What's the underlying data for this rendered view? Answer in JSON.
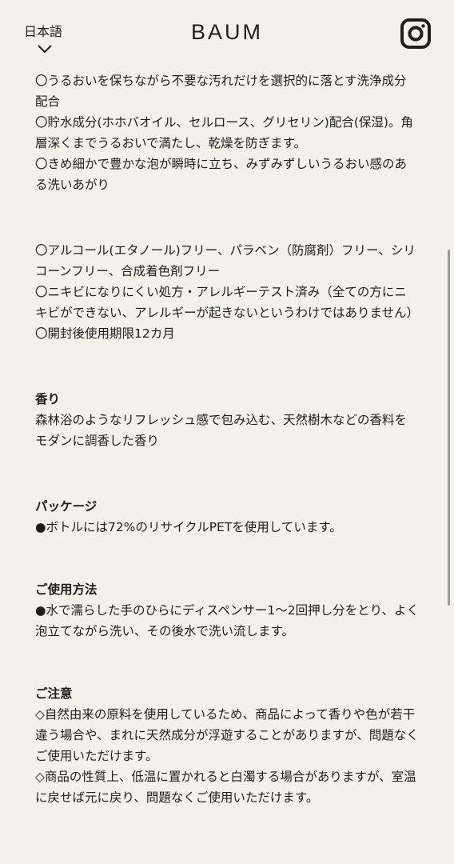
{
  "header": {
    "language_label": "日本語",
    "brand": "BAUM",
    "icons": {
      "language_chevron": "chevron-down-icon",
      "social": "instagram-icon"
    }
  },
  "sections": {
    "features": [
      "〇うるおいを保ちながら不要な汚れだけを選択的に落とす洗浄成分配合",
      "〇貯水成分(ホホバオイル、セルロース、グリセリン)配合(保湿)。角層深くまでうるおいで満たし、乾燥を防ぎます。",
      "〇きめ細かで豊かな泡が瞬時に立ち、みずみずしいうるおい感のある洗いあがり"
    ],
    "free_of": [
      "〇アルコール(エタノール)フリー、パラベン（防腐剤）フリー、シリコーンフリー、合成着色剤フリー",
      "〇ニキビになりにくい処方・アレルギーテスト済み（全ての方にニキビができない、アレルギーが起きないというわけではありません）",
      "〇開封後使用期限12カ月"
    ],
    "fragrance": {
      "heading": "香り",
      "text": "森林浴のようなリフレッシュ感で包み込む、天然樹木などの香料をモダンに調香した香り"
    },
    "package": {
      "heading": "パッケージ",
      "text": "●ボトルには72%のリサイクルPETを使用しています。"
    },
    "usage": {
      "heading": "ご使用方法",
      "text": "●水で濡らした手のひらにディスペンサー1〜2回押し分をとり、よく泡立てながら洗い、その後水で洗い流します。"
    },
    "caution": {
      "heading": "ご注意",
      "items": [
        "◇自然由来の原料を使用しているため、商品によって香りや色が若干違う場合や、まれに天然成分が浮遊することがありますが、問題なくご使用いただけます。",
        "◇商品の性質上、低温に置かれると白濁する場合がありますが、室温に戻せば元に戻り、問題なくご使用いただけます。"
      ]
    }
  }
}
